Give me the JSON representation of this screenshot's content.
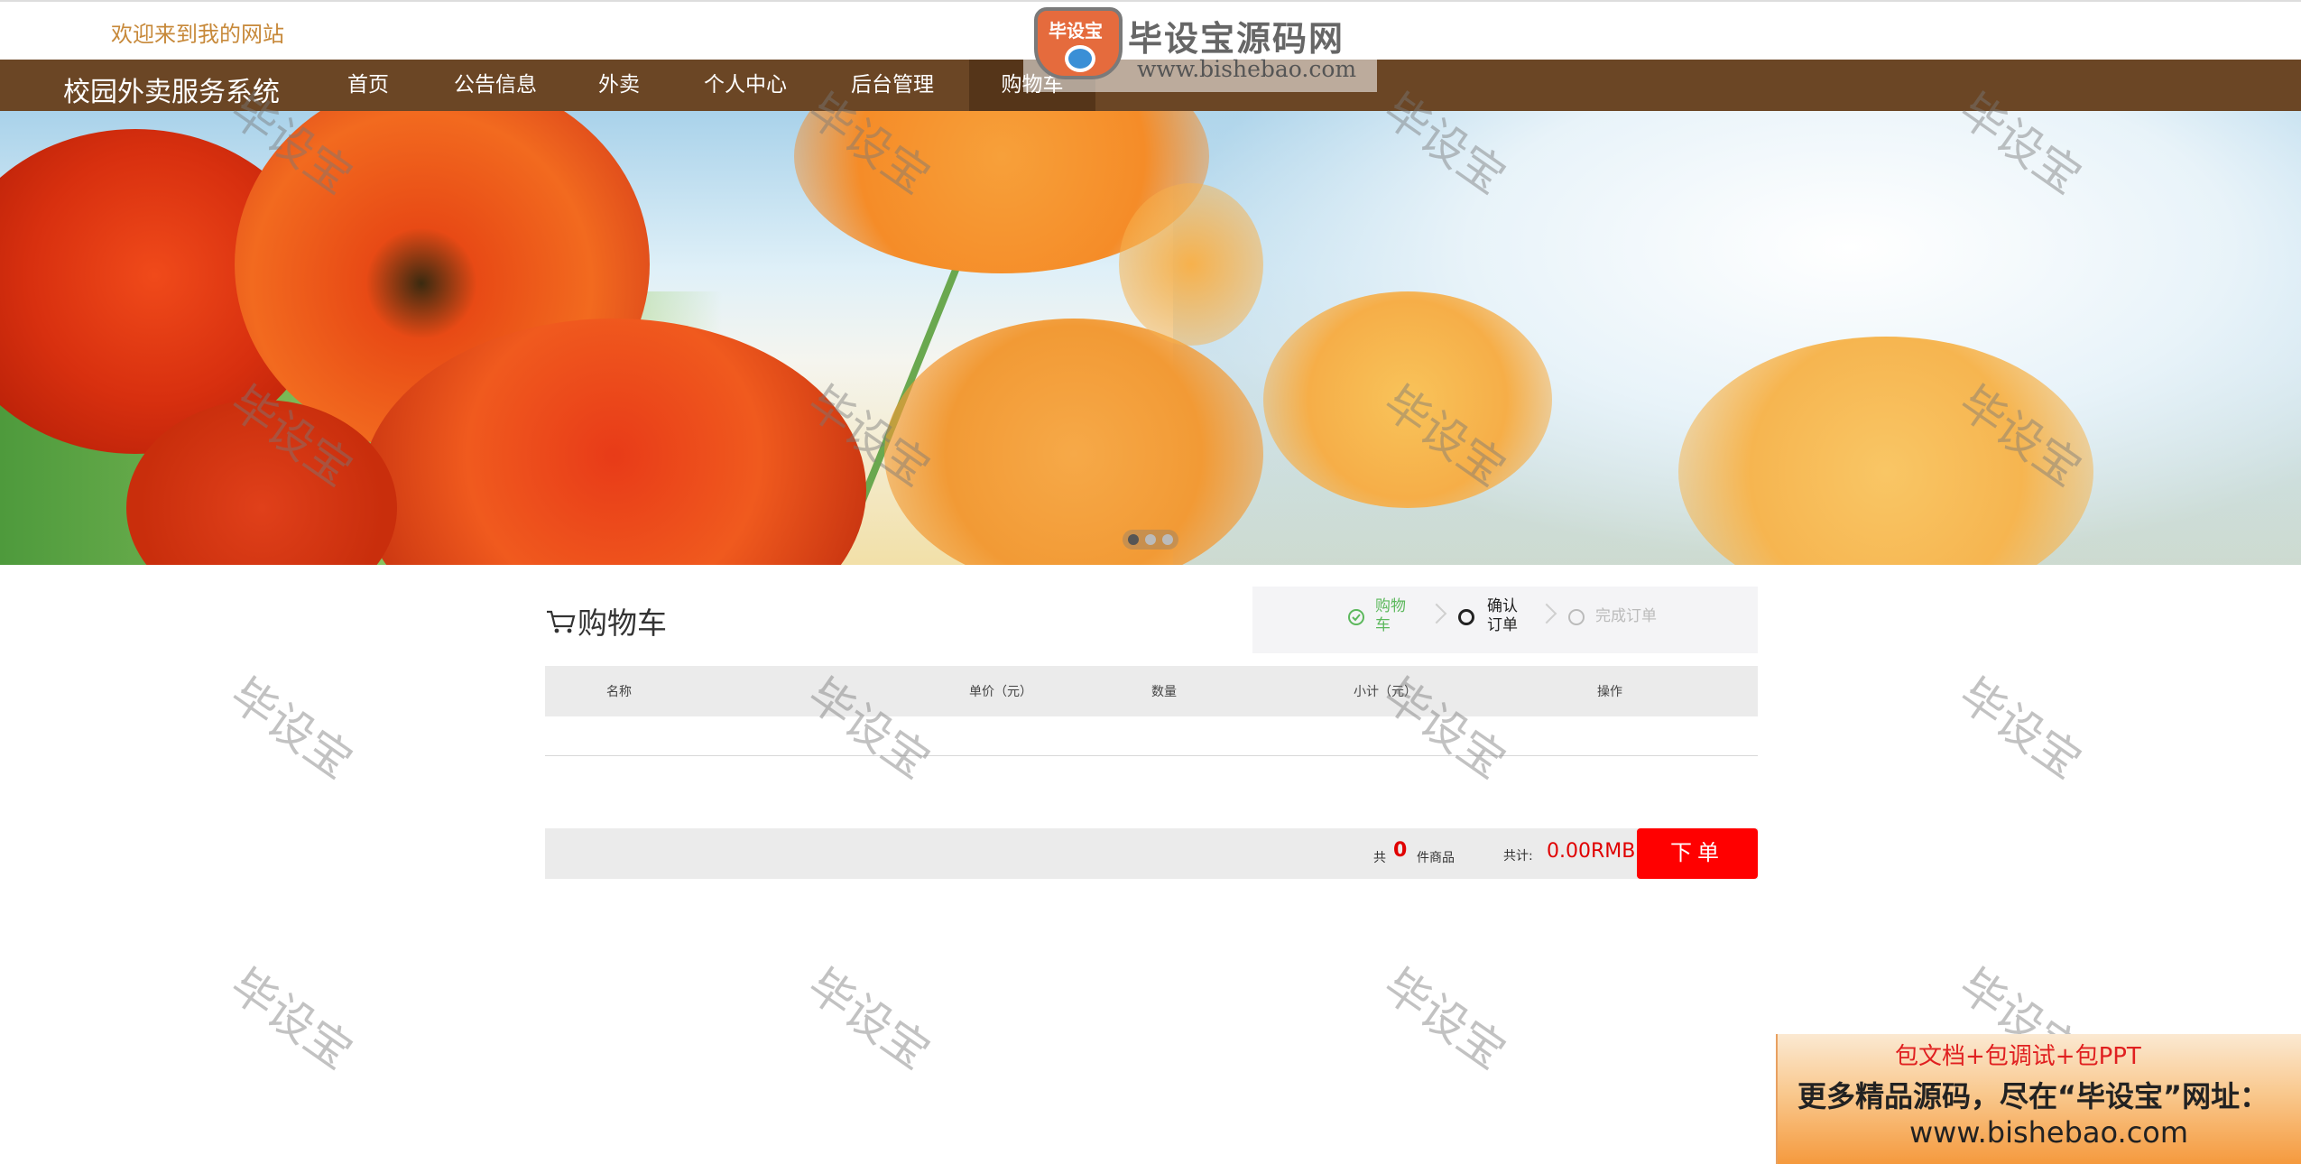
{
  "header": {
    "welcome": "欢迎来到我的网站"
  },
  "navbar": {
    "brand": "校园外卖服务系统",
    "items": [
      {
        "label": "首页",
        "active": false
      },
      {
        "label": "公告信息",
        "active": false
      },
      {
        "label": "外卖",
        "active": false
      },
      {
        "label": "个人中心",
        "active": false
      },
      {
        "label": "后台管理",
        "active": false
      },
      {
        "label": "购物车",
        "active": true
      }
    ]
  },
  "logo_watermark": {
    "badge": "毕设宝",
    "title": "毕设宝源码网",
    "url": "www.bishebao.com"
  },
  "banner": {
    "slides": 3,
    "active_slide": 1
  },
  "cart": {
    "title": "购物车",
    "steps": [
      {
        "label": "购物\n车",
        "state": "done"
      },
      {
        "label": "确认\n订单",
        "state": "current"
      },
      {
        "label": "完成订单",
        "state": "pending"
      }
    ],
    "columns": [
      "名称",
      "单价（元）",
      "数量",
      "小计（元）",
      "操作"
    ],
    "rows": [],
    "summary": {
      "count_prefix": "共",
      "count": "0",
      "count_suffix": "件商品",
      "total_label": "共计:",
      "total": "0.00RMB"
    },
    "order_button": "下单"
  },
  "watermark": {
    "text": "毕设宝"
  },
  "promo": {
    "line1": "包文档+包调试+包PPT",
    "line2": "更多精品源码，尽在“毕设宝”网址：",
    "line3": "www.bishebao.com"
  },
  "colors": {
    "navbar": "#6b4625",
    "accent_red": "#ff0000",
    "welcome": "#c7893a",
    "step_done": "#5cb85c"
  }
}
